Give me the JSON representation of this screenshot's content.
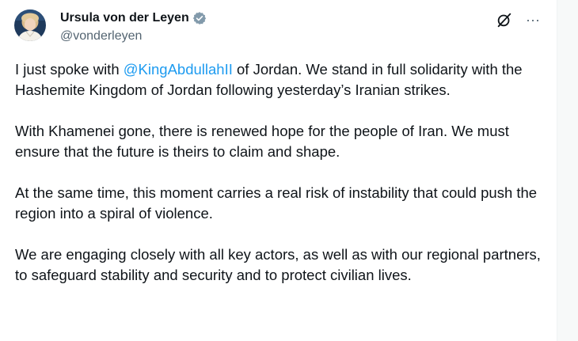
{
  "author": {
    "display_name": "Ursula von der Leyen",
    "handle": "@vonderleyen",
    "verified_icon": "verified-badge-icon",
    "verified_color": "#829aab"
  },
  "header_actions": {
    "grok_icon": "grok-slash-icon",
    "more_icon": "more-horizontal-icon",
    "more_label": "···"
  },
  "tweet": {
    "p1_before": "I just spoke with ",
    "p1_mention": "@KingAbdullahII",
    "p1_after": " of Jordan. We stand in full solidarity with the Hashemite Kingdom of Jordan following yesterday’s Iranian strikes.",
    "p2": "With Khamenei gone, there is renewed hope for the people of Iran. We must ensure that the future is theirs to claim and shape.",
    "p3": "At the same time, this moment carries a real risk of instability that could push the region into a spiral of violence.",
    "p4": "We are engaging closely with all key actors, as well as with our regional partners, to safeguard stability and security and to protect civilian lives."
  },
  "colors": {
    "mention": "#1d9bf0",
    "text": "#0f1419",
    "muted": "#536471"
  }
}
